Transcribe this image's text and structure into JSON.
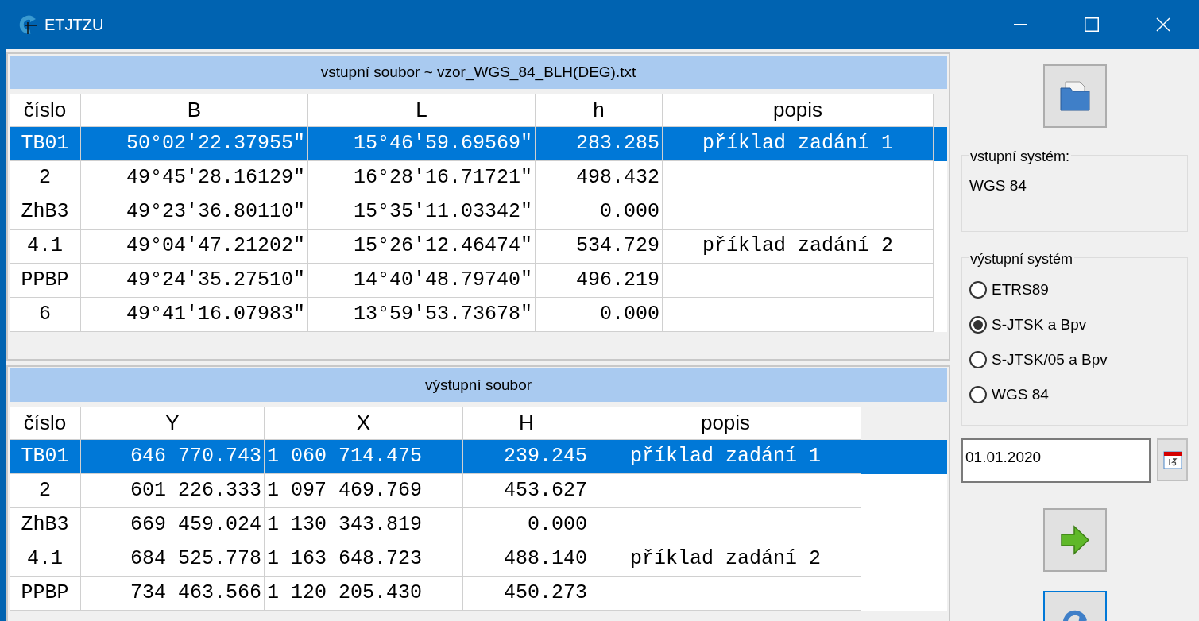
{
  "window": {
    "title": "ETJTZU"
  },
  "input_panel": {
    "title": "vstupní soubor ~ vzor_WGS_84_BLH(DEG).txt",
    "columns": [
      "číslo",
      "B",
      "L",
      "h",
      "popis"
    ],
    "rows": [
      {
        "selected": true,
        "cells": [
          "TB01",
          "50°02'22.37955\"",
          "15°46'59.69569\"",
          "283.285",
          "příklad zadání 1"
        ]
      },
      {
        "selected": false,
        "cells": [
          "2",
          "49°45'28.16129\"",
          "16°28'16.71721\"",
          "498.432",
          ""
        ]
      },
      {
        "selected": false,
        "cells": [
          "ZhB3",
          "49°23'36.80110\"",
          "15°35'11.03342\"",
          "0.000",
          ""
        ]
      },
      {
        "selected": false,
        "cells": [
          "4.1",
          "49°04'47.21202\"",
          "15°26'12.46474\"",
          "534.729",
          "příklad zadání 2"
        ]
      },
      {
        "selected": false,
        "cells": [
          "PPBP",
          "49°24'35.27510\"",
          "14°40'48.79740\"",
          "496.219",
          ""
        ]
      },
      {
        "selected": false,
        "cells": [
          "6",
          "49°41'16.07983\"",
          "13°59'53.73678\"",
          "0.000",
          ""
        ]
      }
    ]
  },
  "output_panel": {
    "title": "výstupní soubor",
    "columns": [
      "číslo",
      "Y",
      "X",
      "H",
      "popis"
    ],
    "rows": [
      {
        "selected": true,
        "cells": [
          "TB01",
          "646 770.743",
          "1 060 714.475",
          "239.245",
          "příklad zadání 1"
        ]
      },
      {
        "selected": false,
        "cells": [
          "2",
          "601 226.333",
          "1 097 469.769",
          "453.627",
          ""
        ]
      },
      {
        "selected": false,
        "cells": [
          "ZhB3",
          "669 459.024",
          "1 130 343.819",
          "0.000",
          ""
        ]
      },
      {
        "selected": false,
        "cells": [
          "4.1",
          "684 525.778",
          "1 163 648.723",
          "488.140",
          "příklad zadání 2"
        ]
      },
      {
        "selected": false,
        "cells": [
          "PPBP",
          "734 463.566",
          "1 120 205.430",
          "450.273",
          ""
        ]
      }
    ]
  },
  "input_system": {
    "label": "vstupní systém:",
    "value": "WGS 84"
  },
  "output_system": {
    "label": "výstupní systém",
    "options": [
      {
        "label": "ETRS89",
        "selected": false
      },
      {
        "label": "S-JTSK a Bpv",
        "selected": true
      },
      {
        "label": "S-JTSK/05 a Bpv",
        "selected": false
      },
      {
        "label": "WGS 84",
        "selected": false
      }
    ]
  },
  "date": {
    "value": "01.01.2020"
  }
}
